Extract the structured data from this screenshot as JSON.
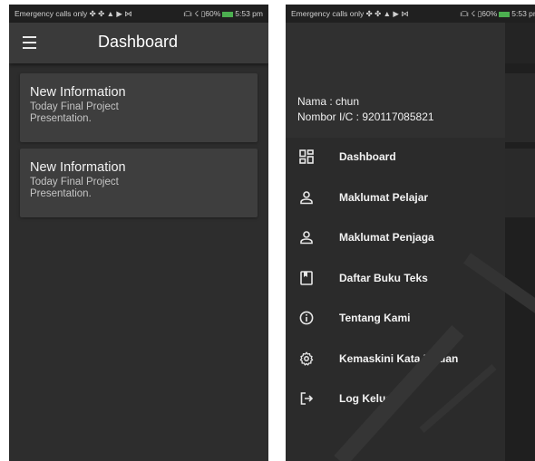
{
  "status_bar": {
    "left_text": "Emergency calls only ✤ ✤ ▲ ▶ ⋈",
    "right_text": "ı⎕ı ☇ ▯60%",
    "time": "5:53 pm"
  },
  "dashboard": {
    "title": "Dashboard",
    "cards": [
      {
        "title": "New Information",
        "body": "Today Final Project Presentation."
      },
      {
        "title": "New Information",
        "body": "Today Final Project Presentation."
      }
    ]
  },
  "drawer": {
    "name_line": "Nama : chun",
    "ic_line": "Nombor I/C : 920117085821",
    "items": [
      {
        "label": "Dashboard",
        "icon": "dashboard-icon"
      },
      {
        "label": "Maklumat Pelajar",
        "icon": "person-icon"
      },
      {
        "label": "Maklumat Penjaga",
        "icon": "person-icon"
      },
      {
        "label": "Daftar Buku Teks",
        "icon": "book-icon"
      },
      {
        "label": "Tentang Kami",
        "icon": "info-icon"
      },
      {
        "label": "Kemaskini Kata Laluan",
        "icon": "gear-icon"
      },
      {
        "label": "Log Keluar",
        "icon": "logout-icon"
      }
    ]
  },
  "colors": {
    "app_background": "#2d2d2d",
    "app_bar": "#3a3a3a",
    "card": "#3e3e3e",
    "drawer_header": "#303030",
    "battery": "#4caf50"
  }
}
